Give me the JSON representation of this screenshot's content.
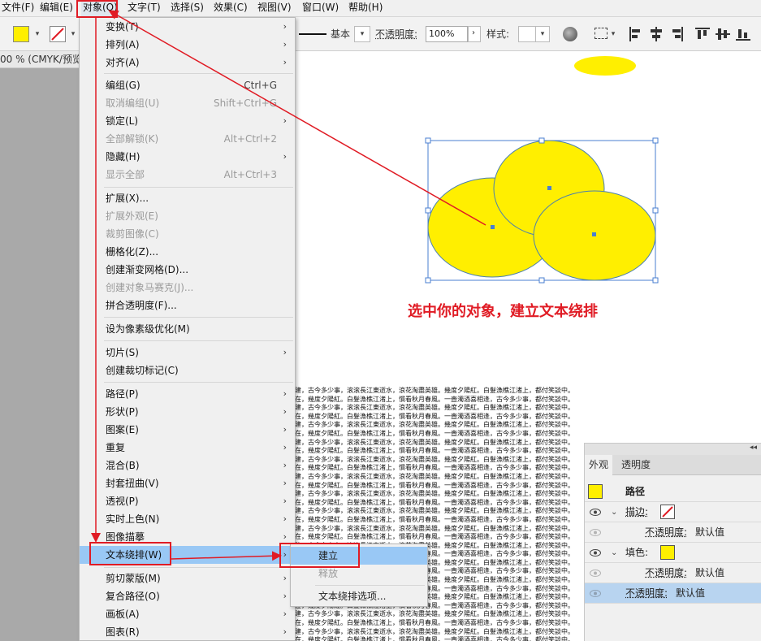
{
  "menubar": {
    "items": [
      "文件(F)",
      "编辑(E)",
      "对象(O)",
      "文字(T)",
      "选择(S)",
      "效果(C)",
      "视图(V)",
      "窗口(W)",
      "帮助(H)"
    ]
  },
  "control_bar": {
    "fill_color": "#ffef00",
    "stroke_style_label": "基本",
    "opacity_label": "不透明度:",
    "opacity_value": "100%",
    "style_label": "样式:"
  },
  "document_tab": "00 % (CMYK/预览)",
  "object_menu": {
    "items": [
      {
        "label": "变换(T)",
        "shortcut": "",
        "submenu": true,
        "disabled": false
      },
      {
        "label": "排列(A)",
        "shortcut": "",
        "submenu": true,
        "disabled": false
      },
      {
        "label": "对齐(A)",
        "shortcut": "",
        "submenu": true,
        "disabled": false
      },
      {
        "label": "编组(G)",
        "shortcut": "Ctrl+G",
        "submenu": false,
        "disabled": false
      },
      {
        "label": "取消编组(U)",
        "shortcut": "Shift+Ctrl+G",
        "submenu": false,
        "disabled": true
      },
      {
        "label": "锁定(L)",
        "shortcut": "",
        "submenu": true,
        "disabled": false
      },
      {
        "label": "全部解锁(K)",
        "shortcut": "Alt+Ctrl+2",
        "submenu": false,
        "disabled": true
      },
      {
        "label": "隐藏(H)",
        "shortcut": "",
        "submenu": true,
        "disabled": false
      },
      {
        "label": "显示全部",
        "shortcut": "Alt+Ctrl+3",
        "submenu": false,
        "disabled": true
      },
      {
        "label": "扩展(X)...",
        "shortcut": "",
        "submenu": false,
        "disabled": false
      },
      {
        "label": "扩展外观(E)",
        "shortcut": "",
        "submenu": false,
        "disabled": true
      },
      {
        "label": "裁剪图像(C)",
        "shortcut": "",
        "submenu": false,
        "disabled": true
      },
      {
        "label": "栅格化(Z)...",
        "shortcut": "",
        "submenu": false,
        "disabled": false
      },
      {
        "label": "创建渐变网格(D)...",
        "shortcut": "",
        "submenu": false,
        "disabled": false
      },
      {
        "label": "创建对象马赛克(J)...",
        "shortcut": "",
        "submenu": false,
        "disabled": true
      },
      {
        "label": "拼合透明度(F)...",
        "shortcut": "",
        "submenu": false,
        "disabled": false
      },
      {
        "label": "设为像素级优化(M)",
        "shortcut": "",
        "submenu": false,
        "disabled": false
      },
      {
        "label": "切片(S)",
        "shortcut": "",
        "submenu": true,
        "disabled": false
      },
      {
        "label": "创建裁切标记(C)",
        "shortcut": "",
        "submenu": false,
        "disabled": false
      },
      {
        "label": "路径(P)",
        "shortcut": "",
        "submenu": true,
        "disabled": false
      },
      {
        "label": "形状(P)",
        "shortcut": "",
        "submenu": true,
        "disabled": false
      },
      {
        "label": "图案(E)",
        "shortcut": "",
        "submenu": true,
        "disabled": false
      },
      {
        "label": "重复",
        "shortcut": "",
        "submenu": true,
        "disabled": false
      },
      {
        "label": "混合(B)",
        "shortcut": "",
        "submenu": true,
        "disabled": false
      },
      {
        "label": "封套扭曲(V)",
        "shortcut": "",
        "submenu": true,
        "disabled": false
      },
      {
        "label": "透视(P)",
        "shortcut": "",
        "submenu": true,
        "disabled": false
      },
      {
        "label": "实时上色(N)",
        "shortcut": "",
        "submenu": true,
        "disabled": false
      },
      {
        "label": "图像描摹",
        "shortcut": "",
        "submenu": true,
        "disabled": false
      },
      {
        "label": "文本绕排(W)",
        "shortcut": "",
        "submenu": true,
        "disabled": false,
        "highlighted": true
      },
      {
        "label": "剪切蒙版(M)",
        "shortcut": "",
        "submenu": true,
        "disabled": false
      },
      {
        "label": "复合路径(O)",
        "shortcut": "",
        "submenu": true,
        "disabled": false
      },
      {
        "label": "画板(A)",
        "shortcut": "",
        "submenu": true,
        "disabled": false
      },
      {
        "label": "图表(R)",
        "shortcut": "",
        "submenu": true,
        "disabled": false
      }
    ]
  },
  "text_wrap_submenu": {
    "items": [
      {
        "label": "建立",
        "disabled": false,
        "highlighted": true
      },
      {
        "label": "释放",
        "disabled": true
      },
      {
        "label": "文本绕排选项...",
        "disabled": false
      }
    ]
  },
  "annotation": "选中你的对象，建立文本绕排",
  "wrap_text": {
    "lines": [
      "建，古今多少事，滚滚長江東逝水，浪花淘盡英雄。幾度夕陽紅。白髮漁樵江渚上，都付笑談中。",
      "在，幾度夕陽紅。白髮漁樵江渚上，慣看秋月春風。一壺濁酒喜相逢，古今多少事，都付笑談中。",
      "建，古今多少事，滚滚長江東逝水，浪花淘盡英雄。幾度夕陽紅。白髮漁樵江渚上，都付笑談中。",
      "在，幾度夕陽紅。白髮漁樵江渚上，慣看秋月春風。一壺濁酒喜相逢，古今多少事，都付笑談中。",
      "建，古今多少事，滚滚長江東逝水，浪花淘盡英雄。幾度夕陽紅。白髮漁樵江渚上，都付笑談中。",
      "在，幾度夕陽紅。白髮漁樵江渚上，慣看秋月春風。一壺濁酒喜相逢，古今多少事，都付笑談中。"
    ]
  },
  "appearance_panel": {
    "tabs": [
      "外观",
      "透明度"
    ],
    "object_label": "路径",
    "stroke_label": "描边:",
    "fill_label": "填色:",
    "opacity_label": "不透明度:",
    "opacity_default": "默认值",
    "fill_color": "#ffef00"
  },
  "colors": {
    "accent_red": "#e01b24",
    "menu_highlight": "#99c8f5",
    "circle_fill": "#ffef00",
    "selection_blue": "#4a7fd0"
  },
  "icons": [
    "chevron-down-icon",
    "submenu-arrow-icon",
    "eye-icon",
    "globe-icon",
    "align-left-icon",
    "align-center-icon",
    "align-right-icon",
    "align-top-icon",
    "align-middle-icon",
    "align-bottom-icon",
    "grid-select-icon",
    "panel-collapse-icon"
  ]
}
